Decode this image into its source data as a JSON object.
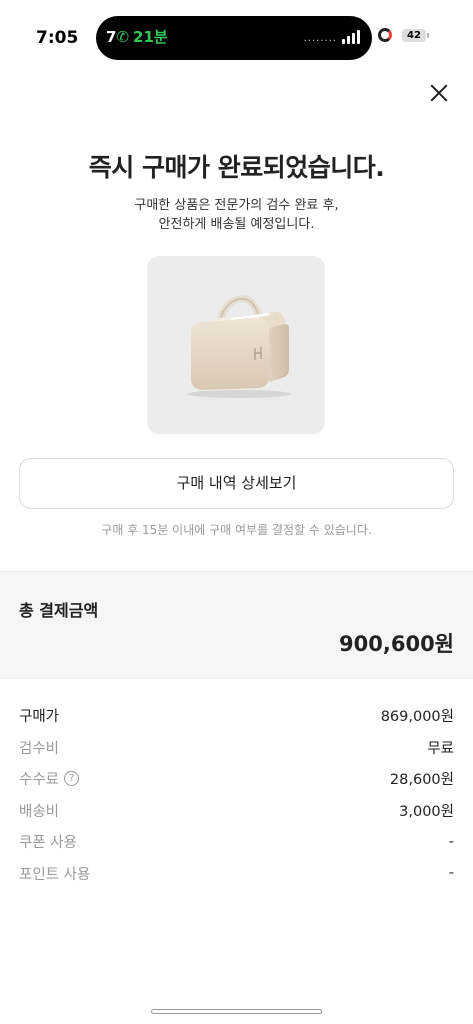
{
  "status_bar": {
    "time": "7:05",
    "time_suffix": "7",
    "call_duration": "21분",
    "battery": "42"
  },
  "page": {
    "title": "즉시 구매가 완료되었습니다.",
    "subtitle_line1": "구매한 상품은 전문가의 검수 완료 후,",
    "subtitle_line2": "안전하게 배송될 예정입니다.",
    "details_button": "구매 내역 상세보기",
    "notice": "구매 후 15분 이내에 구매 여부를 결정할 수 있습니다."
  },
  "total": {
    "label": "총 결제금액",
    "value": "900,600원"
  },
  "breakdown": [
    {
      "label": "구매가",
      "value": "869,000원"
    },
    {
      "label": "검수비",
      "value": "무료"
    },
    {
      "label": "수수료",
      "value": "28,600원"
    },
    {
      "label": "배송비",
      "value": "3,000원"
    },
    {
      "label": "쿠폰 사용",
      "value": "-"
    },
    {
      "label": "포인트 사용",
      "value": "-"
    }
  ],
  "icons": {
    "close": "close-icon",
    "help": "help-icon",
    "product": "product-image"
  },
  "colors": {
    "call_green": "#34c759",
    "notice_gray": "#9a9a9a",
    "total_bg": "#f6f6f6"
  }
}
